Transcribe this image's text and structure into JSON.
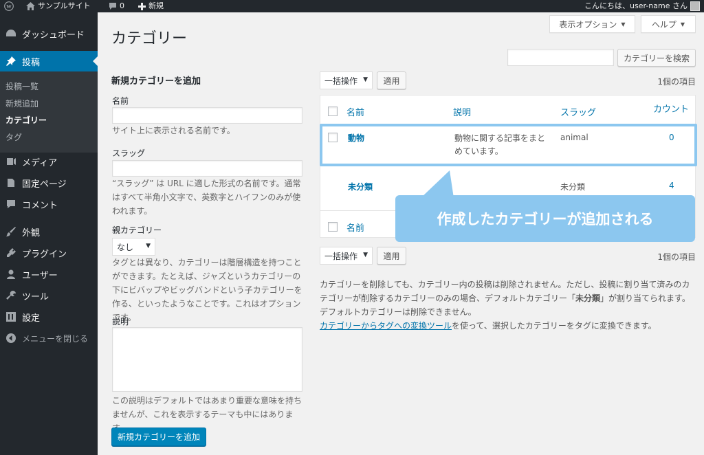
{
  "adminbar": {
    "site_name": "サンプルサイト",
    "comments_count": "0",
    "new_label": "新規",
    "greeting": "こんにちは、user-name さん"
  },
  "sidebar": {
    "dashboard": "ダッシュボード",
    "posts": "投稿",
    "submenu": [
      "投稿一覧",
      "新規追加",
      "カテゴリー",
      "タグ"
    ],
    "media": "メディア",
    "pages": "固定ページ",
    "comments": "コメント",
    "appearance": "外観",
    "plugins": "プラグイン",
    "users": "ユーザー",
    "tools": "ツール",
    "settings": "設定",
    "collapse": "メニューを閉じる"
  },
  "header": {
    "title": "カテゴリー",
    "screen_options": "表示オプション",
    "help": "ヘルプ",
    "search_button": "カテゴリーを検索",
    "search_value": ""
  },
  "form": {
    "heading": "新規カテゴリーを追加",
    "name_label": "名前",
    "name_value": "",
    "name_desc": "サイト上に表示される名前です。",
    "slug_label": "スラッグ",
    "slug_value": "",
    "slug_desc": "“スラッグ” は URL に適した形式の名前です。通常はすべて半角小文字で、英数字とハイフンのみが使われます。",
    "parent_label": "親カテゴリー",
    "parent_selected": "なし",
    "parent_desc": "タグとは異なり、カテゴリーは階層構造を持つことができます。たとえば、ジャズというカテゴリーの下にビバップやビッグバンドという子カテゴリーを作る、といったようなことです。これはオプションです。",
    "description_label": "説明",
    "description_value": "",
    "description_desc": "この説明はデフォルトではあまり重要な意味を持ちませんが、これを表示するテーマも中にはあります。",
    "submit": "新規カテゴリーを追加"
  },
  "table": {
    "bulk_action": "一括操作",
    "apply": "適用",
    "items_count": "1個の項目",
    "columns": [
      "名前",
      "説明",
      "スラッグ",
      "カウント"
    ],
    "rows": [
      {
        "name": "動物",
        "description": "動物に関する記事をまとめています。",
        "slug": "animal",
        "count": "0"
      },
      {
        "name": "未分類",
        "description": "",
        "slug": "未分類",
        "count": "4"
      }
    ],
    "footer_name": "名前"
  },
  "callout": "作成したカテゴリーが追加される",
  "notes": {
    "delete_note_1": "カテゴリーを削除しても、カテゴリー内の投稿は削除されません。ただし、投稿に割り当て済みのカテゴリーが削除するカテゴリーのみの場合、デフォルトカテゴリー「",
    "delete_note_bold": "未分類",
    "delete_note_2": "」が割り当てられます。デフォルトカテゴリーは削除できません。",
    "converter_link": "カテゴリーからタグへの変換ツール",
    "converter_rest": "を使って、選択したカテゴリーをタグに変換できます。"
  }
}
